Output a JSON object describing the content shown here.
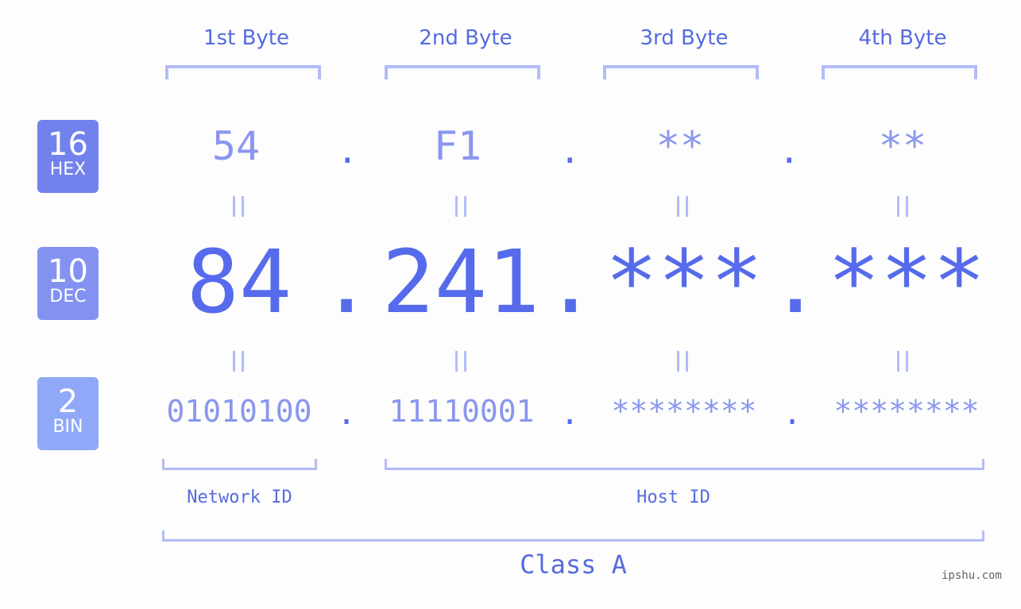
{
  "byte_headers": [
    "1st Byte",
    "2nd Byte",
    "3rd Byte",
    "4th Byte"
  ],
  "badges": [
    {
      "number": "16",
      "label": "HEX",
      "color": "#7282ec"
    },
    {
      "number": "10",
      "label": "DEC",
      "color": "#8392f1"
    },
    {
      "number": "2",
      "label": "BIN",
      "color": "#8fa8f8"
    }
  ],
  "hex": [
    "54",
    "F1",
    "**",
    "**"
  ],
  "dec": [
    "84",
    "241",
    "***",
    "***"
  ],
  "bin": [
    "01010100",
    "11110001",
    "********",
    "********"
  ],
  "separator": ".",
  "equals": "=",
  "network_id_label": "Network ID",
  "host_id_label": "Host ID",
  "class_label": "Class A",
  "watermark": "ipshu.com",
  "colors": {
    "accent": "#566bec",
    "light": "#8a96ee",
    "bracket": "#b3bcf7"
  }
}
